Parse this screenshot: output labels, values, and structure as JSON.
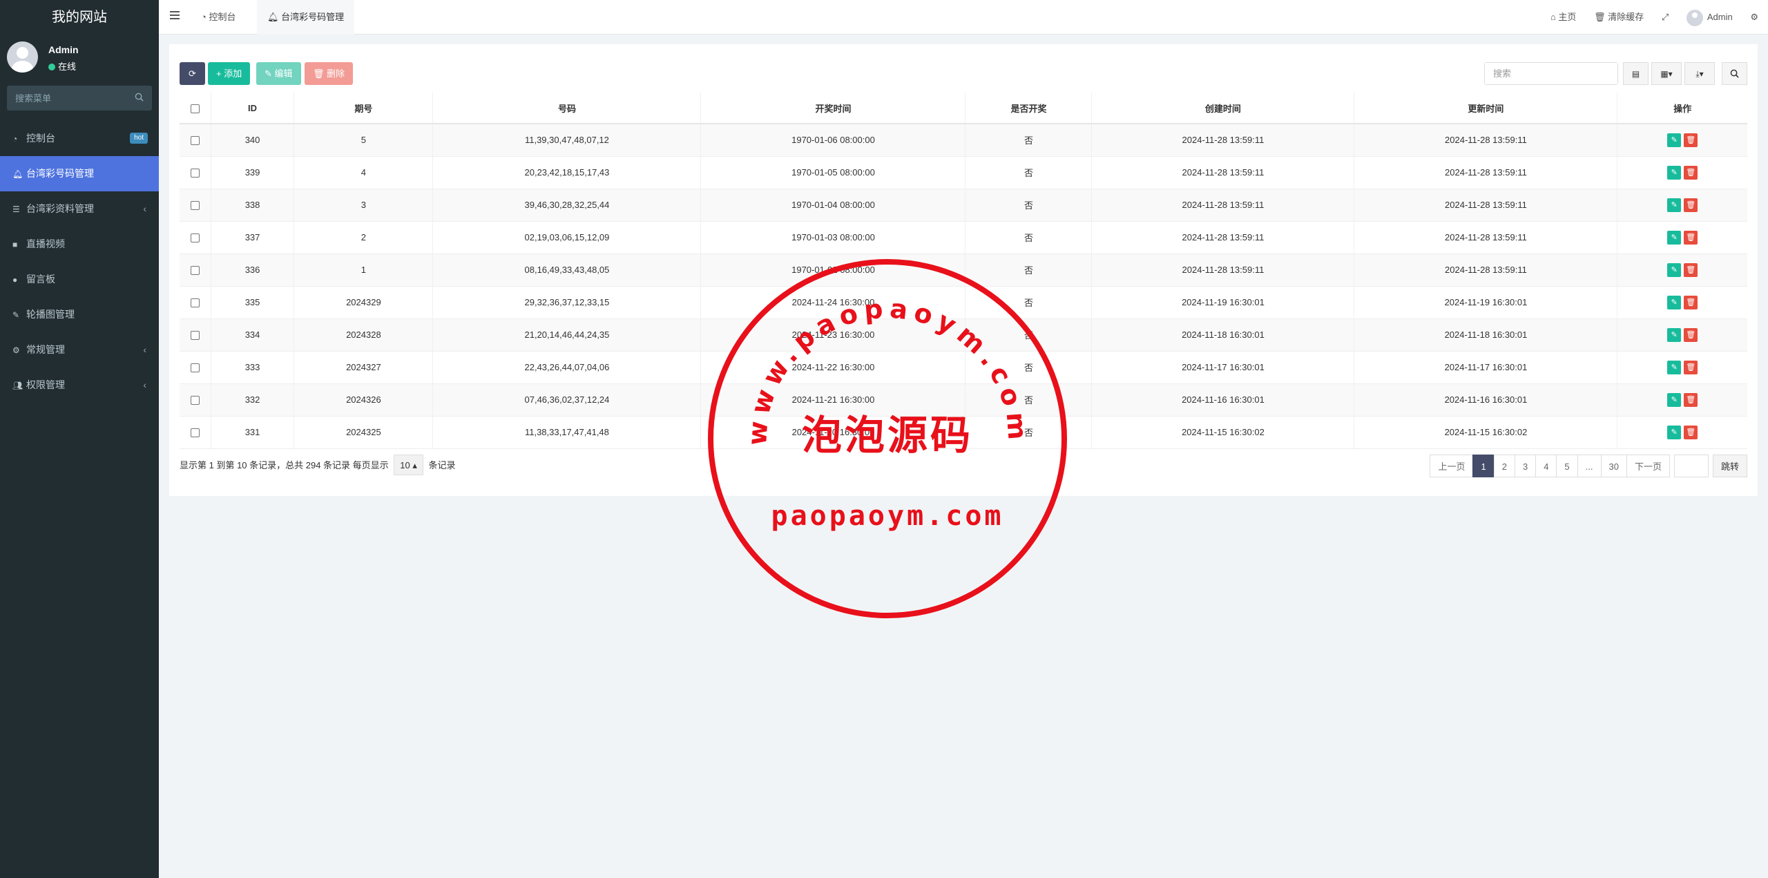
{
  "sidebar": {
    "site_title": "我的网站",
    "user": {
      "name": "Admin",
      "status": "在线"
    },
    "search_placeholder": "搜索菜单",
    "items": [
      {
        "label": "控制台",
        "icon": "dashboard-icon",
        "badge": "hot",
        "active": false
      },
      {
        "label": "台湾彩号码管理",
        "icon": "bell-icon",
        "active": true
      },
      {
        "label": "台湾彩资料管理",
        "icon": "list-icon",
        "has_submenu": true
      },
      {
        "label": "直播视频",
        "icon": "video-icon"
      },
      {
        "label": "留言板",
        "icon": "comment-icon"
      },
      {
        "label": "轮播图管理",
        "icon": "pencil-icon"
      },
      {
        "label": "常规管理",
        "icon": "cogs-icon",
        "has_submenu": true
      },
      {
        "label": "权限管理",
        "icon": "users-icon",
        "has_submenu": true
      }
    ]
  },
  "topbar": {
    "tabs": [
      {
        "label": "控制台",
        "icon": "dashboard-icon"
      },
      {
        "label": "台湾彩号码管理",
        "icon": "bell-icon",
        "active": true
      }
    ],
    "home": "主页",
    "clear_cache": "清除缓存",
    "user": "Admin"
  },
  "toolbar": {
    "add": "添加",
    "edit": "编辑",
    "delete": "删除",
    "search_placeholder": "搜索"
  },
  "table": {
    "headers": [
      "ID",
      "期号",
      "号码",
      "开奖时间",
      "是否开奖",
      "创建时间",
      "更新时间",
      "操作"
    ],
    "rows": [
      [
        "340",
        "5",
        "11,39,30,47,48,07,12",
        "1970-01-06 08:00:00",
        "否",
        "2024-11-28 13:59:11",
        "2024-11-28 13:59:11"
      ],
      [
        "339",
        "4",
        "20,23,42,18,15,17,43",
        "1970-01-05 08:00:00",
        "否",
        "2024-11-28 13:59:11",
        "2024-11-28 13:59:11"
      ],
      [
        "338",
        "3",
        "39,46,30,28,32,25,44",
        "1970-01-04 08:00:00",
        "否",
        "2024-11-28 13:59:11",
        "2024-11-28 13:59:11"
      ],
      [
        "337",
        "2",
        "02,19,03,06,15,12,09",
        "1970-01-03 08:00:00",
        "否",
        "2024-11-28 13:59:11",
        "2024-11-28 13:59:11"
      ],
      [
        "336",
        "1",
        "08,16,49,33,43,48,05",
        "1970-01-02 08:00:00",
        "否",
        "2024-11-28 13:59:11",
        "2024-11-28 13:59:11"
      ],
      [
        "335",
        "2024329",
        "29,32,36,37,12,33,15",
        "2024-11-24 16:30:00",
        "否",
        "2024-11-19 16:30:01",
        "2024-11-19 16:30:01"
      ],
      [
        "334",
        "2024328",
        "21,20,14,46,44,24,35",
        "2024-11-23 16:30:00",
        "否",
        "2024-11-18 16:30:01",
        "2024-11-18 16:30:01"
      ],
      [
        "333",
        "2024327",
        "22,43,26,44,07,04,06",
        "2024-11-22 16:30:00",
        "否",
        "2024-11-17 16:30:01",
        "2024-11-17 16:30:01"
      ],
      [
        "332",
        "2024326",
        "07,46,36,02,37,12,24",
        "2024-11-21 16:30:00",
        "否",
        "2024-11-16 16:30:01",
        "2024-11-16 16:30:01"
      ],
      [
        "331",
        "2024325",
        "11,38,33,17,47,41,48",
        "2024-11-20 16:30:00",
        "否",
        "2024-11-15 16:30:02",
        "2024-11-15 16:30:02"
      ]
    ]
  },
  "footer": {
    "info_prefix": "显示第 1 到第 10 条记录，总共 294 条记录 每页显示",
    "page_size": "10",
    "info_suffix": "条记录",
    "prev": "上一页",
    "next": "下一页",
    "pages": [
      "1",
      "2",
      "3",
      "4",
      "5",
      "...",
      "30"
    ],
    "jump": "跳转"
  },
  "watermark": {
    "arc_text": "www.paopaoym.com",
    "center_text": "泡泡源码",
    "bottom_text": "paopaoym.com",
    "color": "#e8101a"
  }
}
